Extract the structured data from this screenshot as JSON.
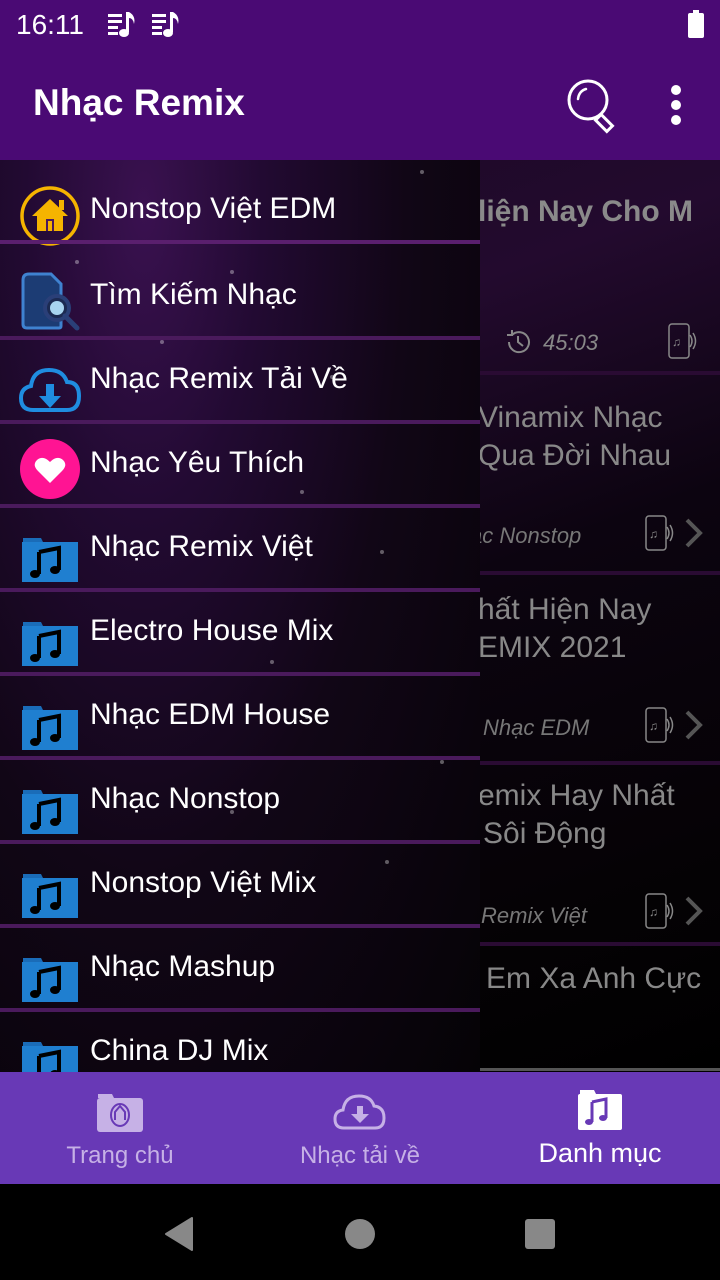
{
  "status_bar": {
    "time": "16:11",
    "notification_icons": [
      "music-playlist-icon",
      "music-playlist-icon"
    ],
    "battery_icon": "battery-full-icon"
  },
  "app_bar": {
    "title": "Nhạc Remix",
    "actions": [
      "search-icon",
      "more-vert-icon"
    ]
  },
  "drawer": {
    "items": [
      {
        "label": "Nonstop Việt EDM",
        "icon": "home-icon"
      },
      {
        "label": "Tìm Kiếm Nhạc",
        "icon": "file-search-icon"
      },
      {
        "label": "Nhạc Remix Tải Về",
        "icon": "cloud-download-icon"
      },
      {
        "label": "Nhạc Yêu Thích",
        "icon": "heart-icon"
      },
      {
        "label": "Nhạc Remix Việt",
        "icon": "music-folder-icon"
      },
      {
        "label": "Electro House Mix",
        "icon": "music-folder-icon"
      },
      {
        "label": "Nhạc EDM House",
        "icon": "music-folder-icon"
      },
      {
        "label": "Nhạc Nonstop",
        "icon": "music-folder-icon"
      },
      {
        "label": "Nonstop Việt Mix",
        "icon": "music-folder-icon"
      },
      {
        "label": "Nhạc Mashup",
        "icon": "music-folder-icon"
      },
      {
        "label": "China DJ Mix",
        "icon": "music-folder-icon"
      }
    ]
  },
  "content": {
    "cards": [
      {
        "title_lines": [
          "liện Nay Cho M"
        ],
        "duration": "45:03",
        "category": ""
      },
      {
        "title_lines": [
          "Vinamix  Nhạc",
          "Qua Đời Nhau"
        ],
        "duration": "",
        "category": "ạc Nonstop"
      },
      {
        "title_lines": [
          "hất Hiện Nay",
          "EMIX 2021"
        ],
        "duration": "",
        "category": "Nhạc EDM"
      },
      {
        "title_lines": [
          "emix Hay Nhất",
          "Sôi Động"
        ],
        "duration": "",
        "category": "Remix Việt"
      },
      {
        "title_lines": [
          "Em Xa Anh Cực"
        ],
        "duration": "",
        "category": ""
      }
    ]
  },
  "bottom_nav": {
    "items": [
      {
        "label": "Trang chủ",
        "icon": "home-folder-icon",
        "active": false
      },
      {
        "label": "Nhạc tải về",
        "icon": "cloud-download-icon",
        "active": false
      },
      {
        "label": "Danh mục",
        "icon": "music-folder-icon",
        "active": true
      }
    ]
  },
  "system_nav": [
    "back-icon",
    "home-icon",
    "recents-icon"
  ],
  "colors": {
    "app_bar": "#4a0a74",
    "bottom_nav": "#6839b6",
    "divider": "#4a1a5c",
    "home_icon": "#f5b400",
    "heart_icon": "#ff1493",
    "folder_icon": "#1f7fd0"
  }
}
